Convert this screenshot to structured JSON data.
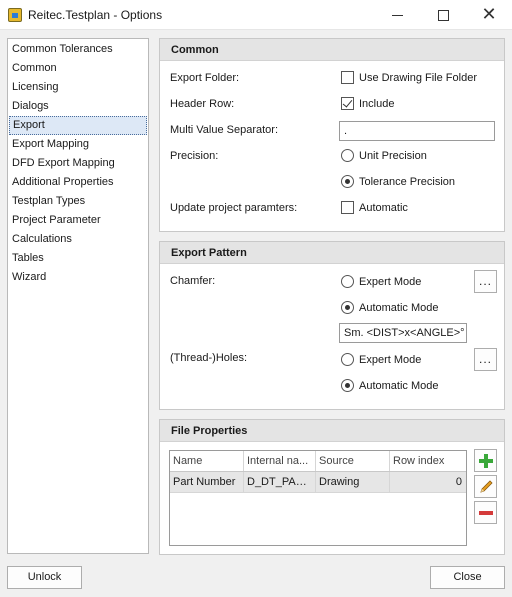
{
  "window": {
    "title": "Reitec.Testplan - Options",
    "app_icon": "testplan-app-icon",
    "controls": {
      "minimize": "—",
      "maximize": "□",
      "close": "✕"
    }
  },
  "sidebar": {
    "selected_index": 4,
    "items": [
      {
        "label": "Common Tolerances"
      },
      {
        "label": "Common"
      },
      {
        "label": "Licensing"
      },
      {
        "label": "Dialogs"
      },
      {
        "label": "Export"
      },
      {
        "label": "Export Mapping"
      },
      {
        "label": "DFD Export Mapping"
      },
      {
        "label": "Additional Properties"
      },
      {
        "label": "Testplan Types"
      },
      {
        "label": "Project Parameter"
      },
      {
        "label": "Calculations"
      },
      {
        "label": "Tables"
      },
      {
        "label": "Wizard"
      }
    ]
  },
  "common": {
    "header": "Common",
    "export_folder_label": "Export Folder:",
    "use_drawing_folder_label": "Use Drawing File Folder",
    "use_drawing_folder_checked": false,
    "header_row_label": "Header Row:",
    "include_label": "Include",
    "include_checked": true,
    "separator_label": "Multi Value Separator:",
    "separator_value": ".",
    "precision_label": "Precision:",
    "unit_precision_label": "Unit Precision",
    "tolerance_precision_label": "Tolerance Precision",
    "precision_selected": "Tolerance Precision",
    "update_label": "Update project paramters:",
    "automatic_label": "Automatic",
    "automatic_checked": false
  },
  "export_pattern": {
    "header": "Export Pattern",
    "chamfer_label": "Chamfer:",
    "chamfer_expert_label": "Expert Mode",
    "chamfer_automatic_label": "Automatic Mode",
    "chamfer_selected": "Automatic Mode",
    "chamfer_pattern": "Sm. <DIST>x<ANGLE>°",
    "holes_label": "(Thread-)Holes:",
    "holes_expert_label": "Expert Mode",
    "holes_automatic_label": "Automatic Mode",
    "holes_selected": "Automatic Mode",
    "browse_label": "..."
  },
  "file_properties": {
    "header": "File Properties",
    "columns": [
      "Name",
      "Internal na...",
      "Source",
      "Row index"
    ],
    "rows": [
      [
        "Part Number",
        "D_DT_PAR...",
        "Drawing",
        "0"
      ]
    ],
    "actions": {
      "add": "plus-icon",
      "edit": "pencil-icon",
      "remove": "minus-icon"
    },
    "colors": {
      "add": "#3aa83a",
      "edit": "#e8a020",
      "remove": "#d43a3a"
    }
  },
  "footer": {
    "unlock_label": "Unlock",
    "close_label": "Close"
  }
}
